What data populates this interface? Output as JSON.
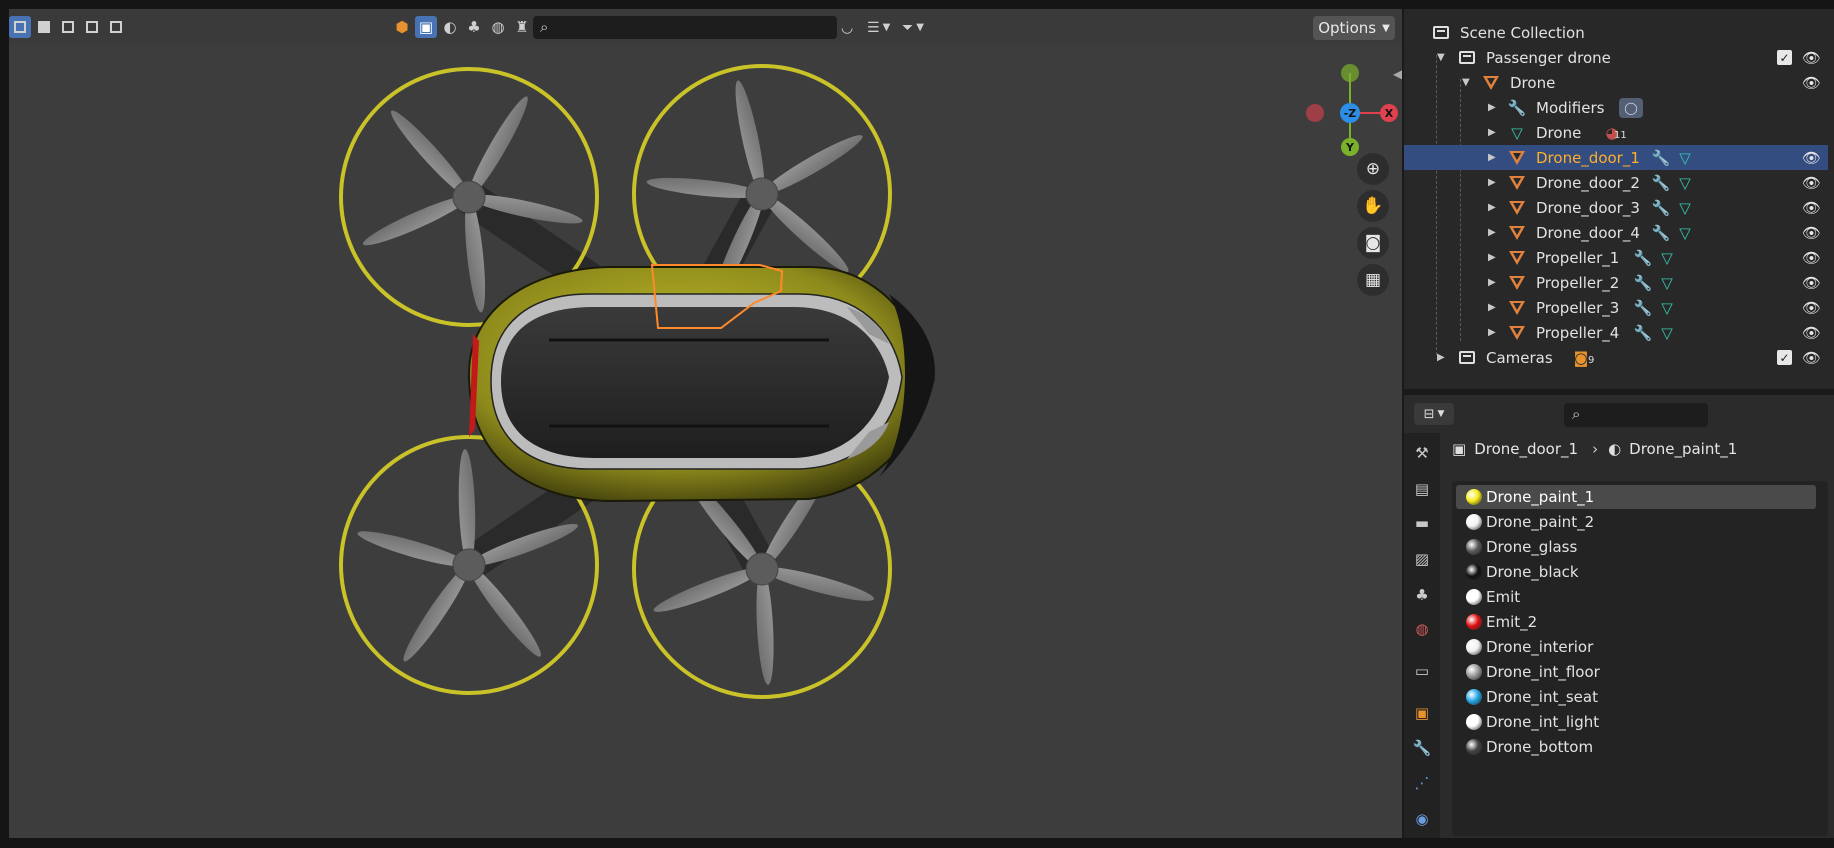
{
  "viewport": {
    "options_label": "Options",
    "gizmo": {
      "neg_z": "-Z",
      "x": "X",
      "y": "Y"
    }
  },
  "outliner": {
    "scene_collection": "Scene Collection",
    "collection": "Passenger drone",
    "parent_object": "Drone",
    "modifiers": "Modifiers",
    "mesh_data": "Drone",
    "mesh_users": "11",
    "objects": [
      "Drone_door_1",
      "Drone_door_2",
      "Drone_door_3",
      "Drone_door_4",
      "Propeller_1",
      "Propeller_2",
      "Propeller_3",
      "Propeller_4"
    ],
    "cameras": "Cameras",
    "camera_count": "9",
    "selected_object": "Drone_door_1"
  },
  "properties": {
    "object_name": "Drone_door_1",
    "material_name": "Drone_paint_1",
    "materials": [
      {
        "name": "Drone_paint_1",
        "color": "#f4ea1a"
      },
      {
        "name": "Drone_paint_2",
        "color": "#f2f2f2"
      },
      {
        "name": "Drone_glass",
        "color": "#5a5a5a"
      },
      {
        "name": "Drone_black",
        "color": "#111111"
      },
      {
        "name": "Emit",
        "color": "#ffffff"
      },
      {
        "name": "Emit_2",
        "color": "#e01010"
      },
      {
        "name": "Drone_interior",
        "color": "#f0f0f0"
      },
      {
        "name": "Drone_int_floor",
        "color": "#9a9a9a"
      },
      {
        "name": "Drone_int_seat",
        "color": "#22a6e6"
      },
      {
        "name": "Drone_int_light",
        "color": "#ffffff"
      },
      {
        "name": "Drone_bottom",
        "color": "#444444"
      }
    ],
    "active_material_index": 0
  },
  "colors": {
    "drone_yellow": "#c9c228",
    "selection_orange": "#ffaf29",
    "axis_x": "#e0414f",
    "axis_y": "#7ab12a",
    "axis_z": "#2c8ee6"
  }
}
